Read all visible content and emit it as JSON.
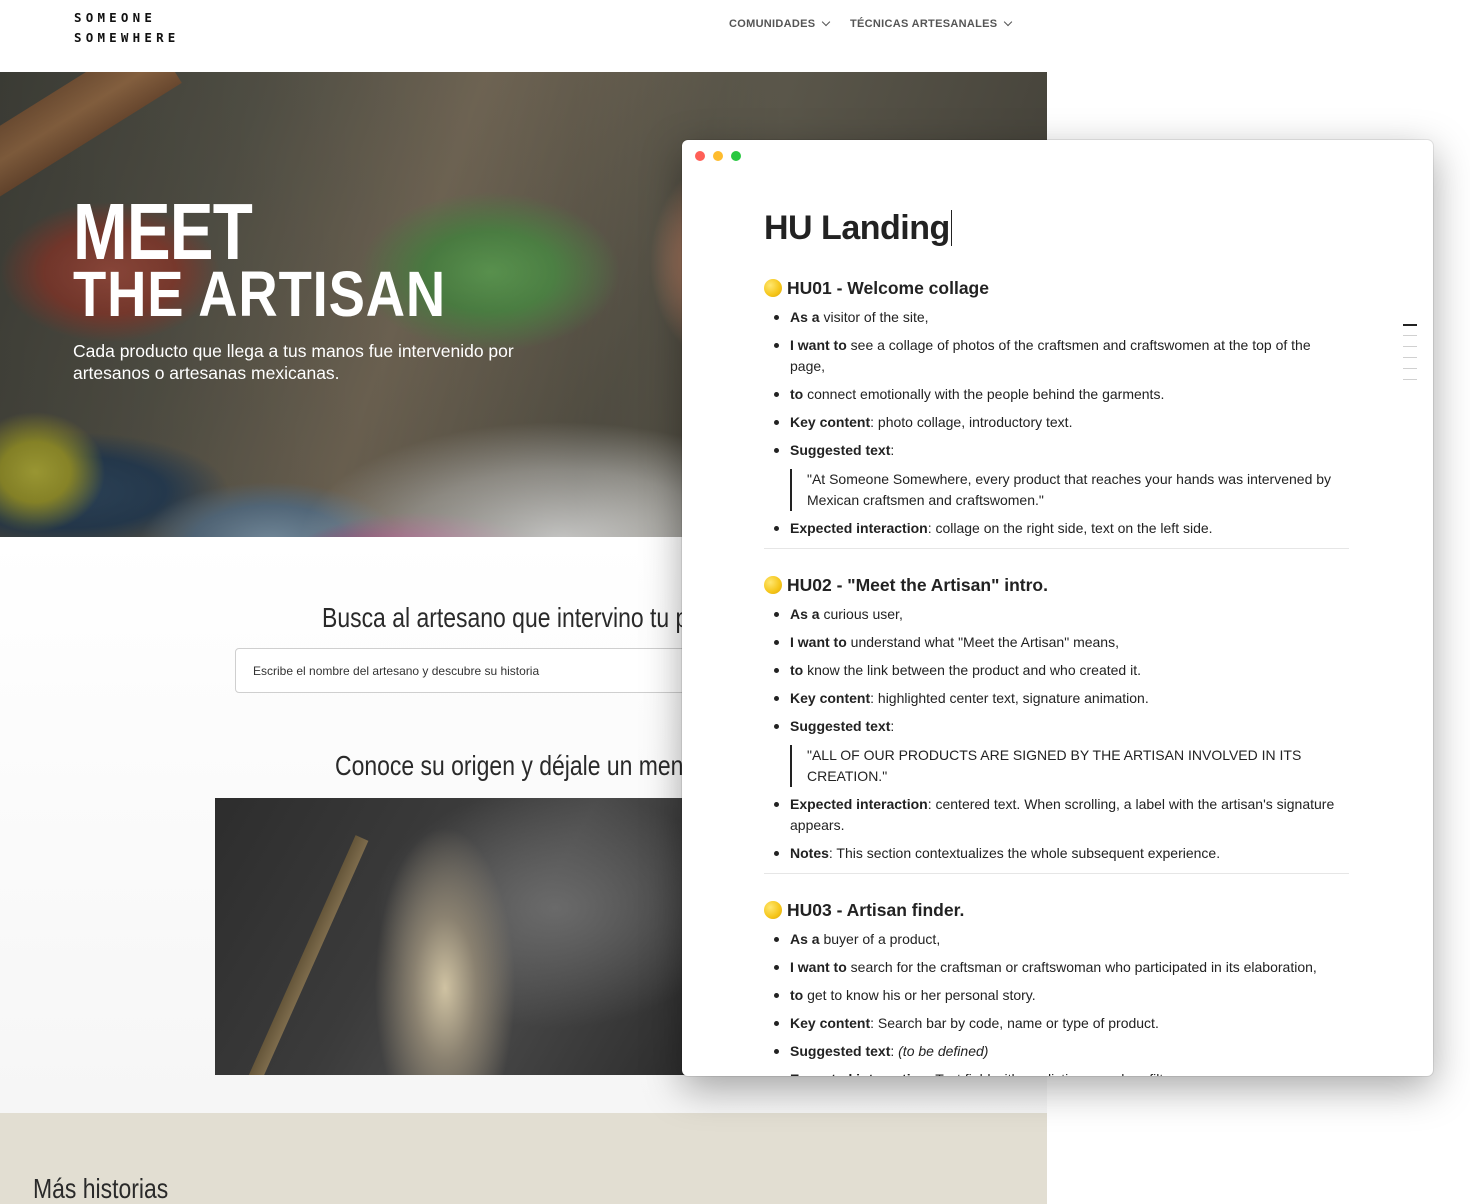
{
  "site": {
    "logo_line1": "SOMEONE",
    "logo_line2": "SOMEWHERE",
    "nav": [
      "COMUNIDADES",
      "TÉCNICAS ARTESANALES"
    ],
    "hero_title_1": "MEET",
    "hero_title_2": "THE ARTISAN",
    "hero_subtitle": "Cada producto que llega a tus manos fue intervenido por artesanos o artesanas mexicanas.",
    "search_title": "Busca al artesano que intervino tu p",
    "search_placeholder": "Escribe el nombre del artesano y descubre su historia",
    "origin_title": "Conoce su origen y déjale un mens",
    "more_title": "Más historias"
  },
  "notes": {
    "title": "HU Landing",
    "stories": [
      {
        "heading": "HU01 - Welcome collage",
        "items": [
          {
            "bold": "As a",
            "text": " visitor of the site,"
          },
          {
            "bold": "I want to",
            "text": " see a collage of photos of the craftsmen and craftswomen at the top of the page,"
          },
          {
            "bold": "to",
            "text": " connect emotionally with the people behind the garments."
          },
          {
            "bold": "Key content",
            "text": ": photo collage, introductory text."
          },
          {
            "bold": "Suggested text",
            "text": ":"
          }
        ],
        "quote": "\"At Someone Somewhere, every product that reaches your hands was intervened by Mexican craftsmen and craftswomen.\"",
        "after": [
          {
            "bold": "Expected interaction",
            "text": ": collage on the right side, text on the left side."
          }
        ]
      },
      {
        "heading": "HU02 - \"Meet the Artisan\" intro.",
        "items": [
          {
            "bold": "As a",
            "text": " curious user,"
          },
          {
            "bold": "I want to",
            "text": " understand what \"Meet the Artisan\" means,"
          },
          {
            "bold": "to",
            "text": " know the link between the product and who created it."
          },
          {
            "bold": "Key content",
            "text": ": highlighted center text, signature animation."
          },
          {
            "bold": "Suggested text",
            "text": ":"
          }
        ],
        "quote": "\"ALL OF OUR PRODUCTS ARE SIGNED BY THE ARTISAN INVOLVED IN ITS CREATION.\"",
        "after": [
          {
            "bold": "Expected interaction",
            "text": ": centered text. When scrolling, a label with the artisan's signature appears."
          },
          {
            "bold": "Notes",
            "text": ": This section contextualizes the whole subsequent experience."
          }
        ]
      },
      {
        "heading": "HU03 - Artisan finder.",
        "items": [
          {
            "bold": "As a",
            "text": " buyer of a product,"
          },
          {
            "bold": "I want to",
            "text": " search for the craftsman or craftswoman who participated in its elaboration,"
          },
          {
            "bold": "to",
            "text": " get to know his or her personal story."
          },
          {
            "bold": "Key content",
            "text": ": Search bar by code, name or type of product."
          },
          {
            "bold": "Suggested text",
            "text": ": ",
            "italic": "(to be defined)"
          },
          {
            "bold": "Expected interaction",
            "text": ": Text field with predictive search or filters."
          }
        ]
      }
    ]
  }
}
